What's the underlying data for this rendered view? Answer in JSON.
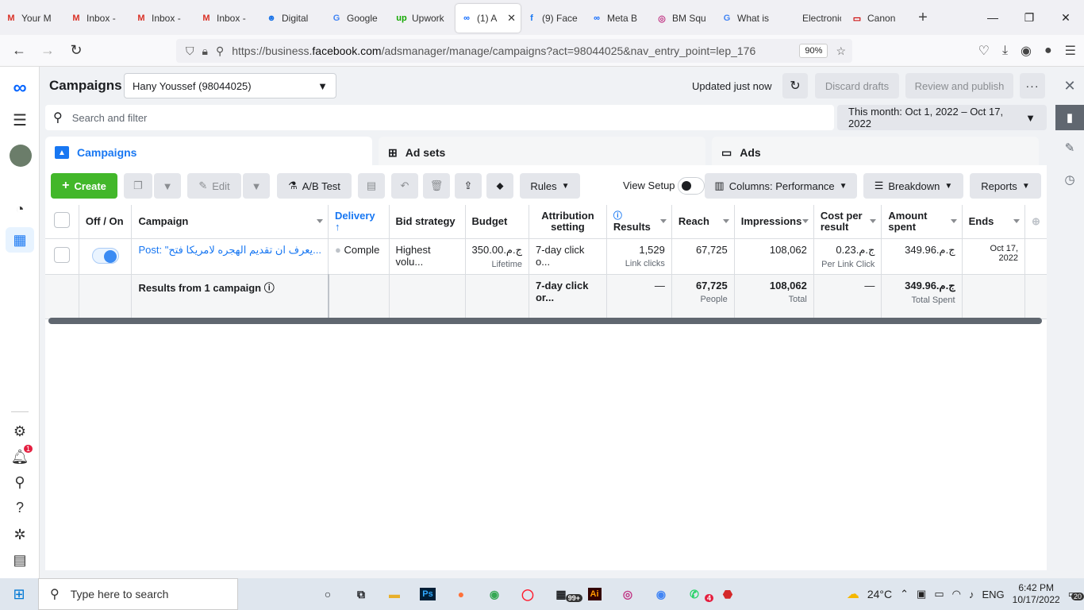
{
  "browser": {
    "tabs": [
      {
        "label": "Your M",
        "icon": "gmail-icon",
        "color": "#d93025",
        "glyph": "M"
      },
      {
        "label": "Inbox -",
        "icon": "gmail-icon",
        "color": "#d93025",
        "glyph": "M"
      },
      {
        "label": "Inbox -",
        "icon": "gmail-icon",
        "color": "#d93025",
        "glyph": "M"
      },
      {
        "label": "Inbox -",
        "icon": "gmail-icon",
        "color": "#d93025",
        "glyph": "M"
      },
      {
        "label": "Digital",
        "icon": "robot-icon",
        "color": "#1a73e8",
        "glyph": "☻"
      },
      {
        "label": "Google",
        "icon": "google-translate-icon",
        "color": "#4285f4",
        "glyph": "G"
      },
      {
        "label": "Upwork",
        "icon": "upwork-icon",
        "color": "#14a800",
        "glyph": "up"
      },
      {
        "label": "(1) A",
        "icon": "meta-icon",
        "color": "#0866ff",
        "glyph": "∞",
        "active": true
      },
      {
        "label": "(9) Face",
        "icon": "facebook-icon",
        "color": "#1877f2",
        "glyph": "f"
      },
      {
        "label": "Meta B",
        "icon": "meta-icon",
        "color": "#0866ff",
        "glyph": "∞"
      },
      {
        "label": "BM Squ",
        "icon": "instagram-icon",
        "color": "#c13584",
        "glyph": "◎"
      },
      {
        "label": "What is",
        "icon": "google-icon",
        "color": "#4285f4",
        "glyph": "G"
      },
      {
        "label": "Electronic D",
        "icon": "blank-icon",
        "color": "#888888",
        "glyph": ""
      },
      {
        "label": "Canon",
        "icon": "canon-icon",
        "color": "#cc0000",
        "glyph": "▭"
      }
    ],
    "url_prefix": "https://business.",
    "url_domain": "facebook.com",
    "url_rest": "/adsmanager/manage/campaigns?act=98044025&nav_entry_point=lep_176",
    "zoom": "90%"
  },
  "header": {
    "title": "Campaigns",
    "account": "Hany Youssef (98044025)",
    "updated": "Updated just now",
    "discard": "Discard drafts",
    "review": "Review and publish"
  },
  "search": {
    "placeholder": "Search and filter"
  },
  "date_range": "This month: Oct 1, 2022 – Oct 17, 2022",
  "level_tabs": {
    "campaigns": "Campaigns",
    "adsets": "Ad sets",
    "ads": "Ads"
  },
  "toolbar": {
    "create": "Create",
    "edit": "Edit",
    "ab_test": "A/B Test",
    "rules": "Rules",
    "view_setup": "View Setup",
    "columns": "Columns: Performance",
    "breakdown": "Breakdown",
    "reports": "Reports"
  },
  "table": {
    "headers": {
      "off_on": "Off / On",
      "campaign": "Campaign",
      "delivery": "Delivery",
      "bid": "Bid strategy",
      "budget": "Budget",
      "attribution": "Attribution setting",
      "results": "Results",
      "reach": "Reach",
      "impressions": "Impressions",
      "cpr": "Cost per result",
      "spent": "Amount spent",
      "ends": "Ends"
    },
    "row": {
      "campaign": "Post: \"يعرف ان تقديم الهجره لامريكا فتح...",
      "delivery": "Comple",
      "bid": "Highest volu...",
      "budget": "ج.م.350.00",
      "budget_sub": "Lifetime",
      "attribution": "7-day click o...",
      "results": "1,529",
      "results_sub": "Link clicks",
      "reach": "67,725",
      "impressions": "108,062",
      "cpr": "ج.م.0.23",
      "cpr_sub": "Per Link Click",
      "spent": "ج.م.349.96",
      "ends": "Oct 17, 2022"
    },
    "total": {
      "label": "Results from 1 campaign",
      "attribution": "7-day click or...",
      "results": "—",
      "reach": "67,725",
      "reach_sub": "People",
      "impressions": "108,062",
      "impressions_sub": "Total",
      "cpr": "—",
      "spent": "ج.م.349.96",
      "spent_sub": "Total Spent"
    }
  },
  "left_nav": {
    "notification_count": "1"
  },
  "taskbar": {
    "search_placeholder": "Type here to search",
    "badge_99": "99+",
    "ai_label": "Ai",
    "ps_label": "Ps",
    "whatsapp_count": "4",
    "weather": "24°C",
    "lang": "ENG",
    "time": "6:42 PM",
    "date": "10/17/2022",
    "notif_count": "20"
  }
}
